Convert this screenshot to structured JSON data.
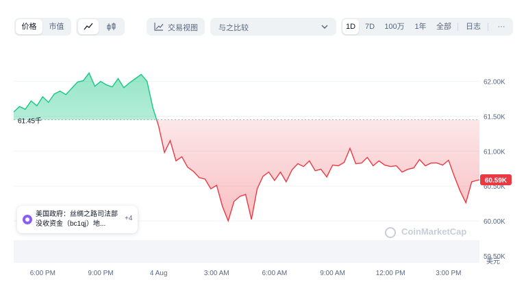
{
  "toolbar": {
    "tab_price": "价格",
    "tab_marketcap": "市值",
    "trading_view": "交易视图",
    "compare_placeholder": "与之比较",
    "ranges": [
      "1D",
      "7D",
      "100万",
      "1年",
      "全部"
    ],
    "active_range": "1D",
    "log_label": "日志",
    "more_label": "···"
  },
  "reference_label": "61.45千",
  "current_price_label": "60.59K",
  "currency_label": "美元",
  "tooltip": {
    "text": "美国政府：丝绸之路司法部没收资金（bc1qj）地...",
    "more_count": "+4"
  },
  "watermark": "CoinMarketCap",
  "colors": {
    "up": "#16c784",
    "down": "#ea3943",
    "accent": "#3861fb"
  },
  "chart_data": {
    "type": "area",
    "title": "",
    "xlabel": "",
    "ylabel": "美元",
    "baseline": 61450,
    "current": 60590,
    "ylim": [
      59400,
      62350
    ],
    "y_ticks": [
      62000,
      61500,
      61000,
      60500,
      60000,
      59500
    ],
    "y_tick_labels": [
      "62.00K",
      "61.50K",
      "61.00K",
      "60.50K",
      "60.00K",
      "59.50K"
    ],
    "x_ticks": [
      -7,
      -4,
      -1,
      2,
      5,
      8,
      11,
      14
    ],
    "x_tick_labels": [
      "6:00 PM",
      "9:00 PM",
      "4 Aug",
      "3:00 AM",
      "6:00 AM",
      "9:00 AM",
      "12:00 PM",
      "3:00 PM"
    ],
    "x_range": [
      -8.5,
      15.6
    ],
    "x_unit": "hours from 00:00 4 Aug",
    "grid": true,
    "series": [
      {
        "x": [
          -8.5,
          -8.2,
          -7.9,
          -7.6,
          -7.3,
          -7.0,
          -6.7,
          -6.4,
          -6.1,
          -5.8,
          -5.5,
          -5.2,
          -4.9,
          -4.6,
          -4.3,
          -4.0,
          -3.7,
          -3.4,
          -3.1,
          -2.8,
          -2.5,
          -2.2,
          -1.9,
          -1.6,
          -1.3,
          -1.0,
          -0.7,
          -0.4,
          -0.1,
          0.2,
          0.5,
          0.8,
          1.1,
          1.4,
          1.7,
          2.0,
          2.3,
          2.6,
          2.9,
          3.2,
          3.5,
          3.8,
          4.1,
          4.4,
          4.7,
          5.0,
          5.3,
          5.6,
          5.9,
          6.2,
          6.5,
          6.8,
          7.1,
          7.4,
          7.7,
          8.0,
          8.3,
          8.6,
          8.9,
          9.2,
          9.5,
          9.8,
          10.1,
          10.4,
          10.7,
          11.0,
          11.3,
          11.6,
          11.9,
          12.2,
          12.5,
          12.8,
          13.1,
          13.4,
          13.7,
          14.0,
          14.3,
          14.6,
          14.9,
          15.2,
          15.6
        ],
        "values": [
          61560,
          61640,
          61600,
          61720,
          61650,
          61780,
          61700,
          61820,
          61860,
          61810,
          61900,
          61990,
          62010,
          62120,
          61930,
          62000,
          61950,
          61920,
          62040,
          61910,
          61980,
          62040,
          62100,
          62000,
          61620,
          61360,
          60980,
          61150,
          60860,
          60920,
          60770,
          60710,
          60620,
          60600,
          60460,
          60510,
          60210,
          60000,
          60280,
          60350,
          60380,
          60020,
          60460,
          60640,
          60700,
          60580,
          60700,
          60560,
          60730,
          60820,
          60780,
          60860,
          60720,
          60740,
          60630,
          60800,
          60790,
          60840,
          61040,
          60820,
          60830,
          60910,
          60790,
          60860,
          60800,
          60780,
          60790,
          60700,
          60740,
          60760,
          60880,
          60790,
          60830,
          60830,
          60800,
          60870,
          60640,
          60430,
          60260,
          60560,
          60590
        ]
      }
    ]
  }
}
